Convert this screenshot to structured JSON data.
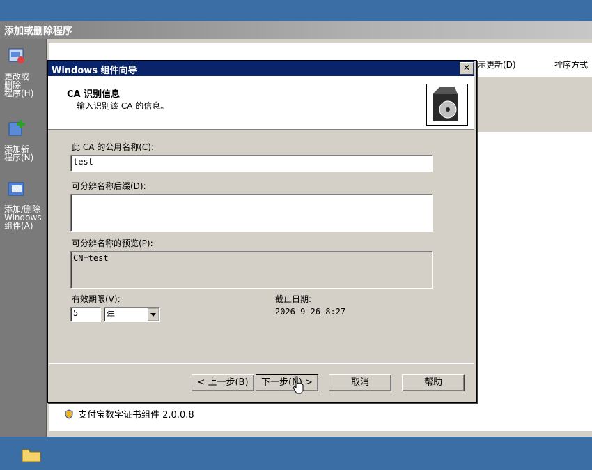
{
  "background_window": {
    "title": "添加或删除程序",
    "sidebar": [
      {
        "label": "更改或\n删除\n程序(H)",
        "icon": "change-remove-icon"
      },
      {
        "label": "添加新\n程序(N)",
        "icon": "add-program-icon"
      },
      {
        "label": "添加/删除\nWindows\n组件(A)",
        "icon": "windows-components-icon"
      }
    ],
    "toolbar_text": "示更新(D)",
    "sort_label": "排序方式",
    "list_item": "支付宝数字证书组件 2.0.0.8"
  },
  "dialog": {
    "title": "Windows 组件向导",
    "header_title": "CA 识别信息",
    "header_subtitle": "输入识别该 CA 的信息。",
    "common_name_label": "此 CA 的公用名称(C):",
    "common_name_value": "test",
    "dn_suffix_label": "可分辨名称后缀(D):",
    "dn_suffix_value": "",
    "dn_preview_label": "可分辨名称的预览(P):",
    "dn_preview_value": "CN=test",
    "validity_label": "有效期限(V):",
    "validity_value": "5",
    "validity_unit": "年",
    "expiry_label": "截止日期:",
    "expiry_value": "2026-9-26 8:27",
    "buttons": {
      "back": "< 上一步(B)",
      "next": "下一步(N) >",
      "cancel": "取消",
      "help": "帮助"
    },
    "close_glyph": "✕"
  },
  "colors": {
    "desktop": "#3a6ea5",
    "dialog_title": "#0a246a",
    "face": "#d4d0c8"
  }
}
